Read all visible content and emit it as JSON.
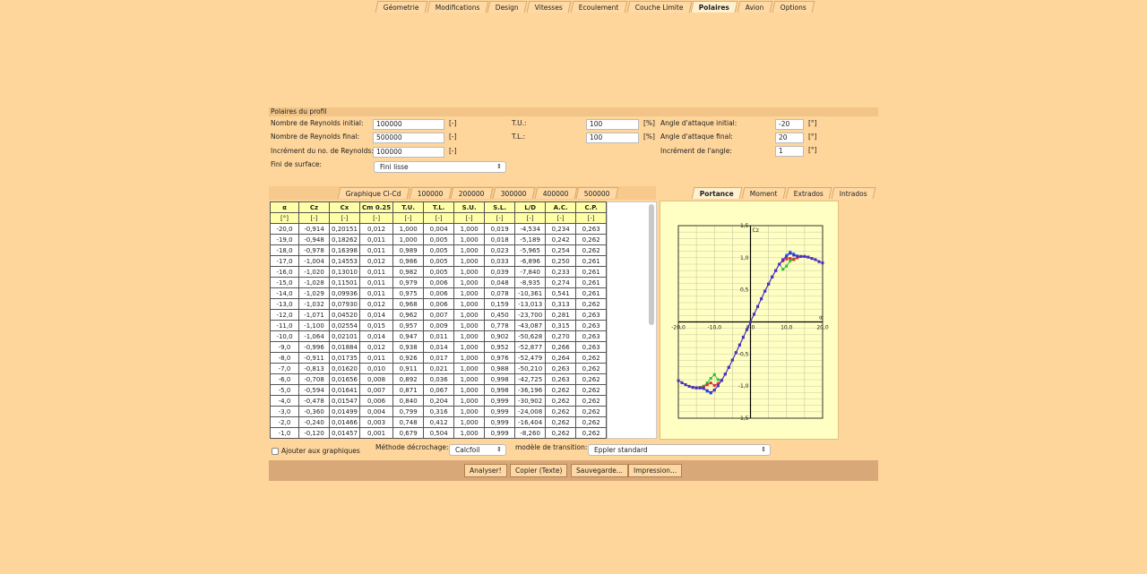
{
  "top_tabs": [
    {
      "label": "Géometrie"
    },
    {
      "label": "Modifications"
    },
    {
      "label": "Design"
    },
    {
      "label": "Vitesses"
    },
    {
      "label": "Ecoulement"
    },
    {
      "label": "Couche Limite"
    },
    {
      "label": "Polaires",
      "active": true
    },
    {
      "label": "Avion"
    },
    {
      "label": "Options"
    }
  ],
  "section_title": "Polaires du profil",
  "form": {
    "re_initial": {
      "label": "Nombre de Reynolds initial:",
      "value": "100000",
      "unit": "[-]"
    },
    "re_final": {
      "label": "Nombre de Reynolds final:",
      "value": "500000",
      "unit": "[-]"
    },
    "re_increment": {
      "label": "Incrément du no. de Reynolds:",
      "value": "100000",
      "unit": "[-]"
    },
    "surface": {
      "label": "Fini de surface:",
      "value": "Fini lisse"
    },
    "tu": {
      "label": "T.U.:",
      "value": "100",
      "unit": "[%]"
    },
    "tl": {
      "label": "T.L.:",
      "value": "100",
      "unit": "[%]"
    },
    "aoa_initial": {
      "label": "Angle d'attaque initial:",
      "value": "-20",
      "unit": "[°]"
    },
    "aoa_final": {
      "label": "Angle d'attaque final:",
      "value": "20",
      "unit": "[°]"
    },
    "aoa_increment": {
      "label": "Incrément de l'angle:",
      "value": "1",
      "unit": "[°]"
    }
  },
  "result_tabs": [
    {
      "label": "Graphique Cl-Cd"
    },
    {
      "label": "100000"
    },
    {
      "label": "200000"
    },
    {
      "label": "300000"
    },
    {
      "label": "400000"
    },
    {
      "label": "500000"
    }
  ],
  "chart_tabs": [
    {
      "label": "Portance",
      "active": true
    },
    {
      "label": "Moment"
    },
    {
      "label": "Extrados"
    },
    {
      "label": "Intrados"
    }
  ],
  "table": {
    "headers": [
      "α",
      "Cz",
      "Cx",
      "Cm 0.25",
      "T.U.",
      "T.L.",
      "S.U.",
      "S.L.",
      "L/D",
      "A.C.",
      "C.P."
    ],
    "units": [
      "[°]",
      "[-]",
      "[-]",
      "[-]",
      "[-]",
      "[-]",
      "[-]",
      "[-]",
      "[-]",
      "[-]",
      "[-]"
    ],
    "rows": [
      [
        "-20,0",
        "-0,914",
        "0,20151",
        "0,012",
        "1,000",
        "0,004",
        "1,000",
        "0,019",
        "-4,534",
        "0,234",
        "0,263"
      ],
      [
        "-19,0",
        "-0,948",
        "0,18262",
        "0,011",
        "1,000",
        "0,005",
        "1,000",
        "0,018",
        "-5,189",
        "0,242",
        "0,262"
      ],
      [
        "-18,0",
        "-0,978",
        "0,16398",
        "0,011",
        "0,989",
        "0,005",
        "1,000",
        "0,023",
        "-5,965",
        "0,254",
        "0,262"
      ],
      [
        "-17,0",
        "-1,004",
        "0,14553",
        "0,012",
        "0,986",
        "0,005",
        "1,000",
        "0,033",
        "-6,896",
        "0,250",
        "0,261"
      ],
      [
        "-16,0",
        "-1,020",
        "0,13010",
        "0,011",
        "0,982",
        "0,005",
        "1,000",
        "0,039",
        "-7,840",
        "0,233",
        "0,261"
      ],
      [
        "-15,0",
        "-1,028",
        "0,11501",
        "0,011",
        "0,979",
        "0,006",
        "1,000",
        "0,048",
        "-8,935",
        "0,274",
        "0,261"
      ],
      [
        "-14,0",
        "-1,029",
        "0,09936",
        "0,011",
        "0,975",
        "0,006",
        "1,000",
        "0,078",
        "-10,361",
        "0,541",
        "0,261"
      ],
      [
        "-13,0",
        "-1,032",
        "0,07930",
        "0,012",
        "0,968",
        "0,006",
        "1,000",
        "0,159",
        "-13,013",
        "0,313",
        "0,262"
      ],
      [
        "-12,0",
        "-1,071",
        "0,04520",
        "0,014",
        "0,962",
        "0,007",
        "1,000",
        "0,450",
        "-23,700",
        "0,281",
        "0,263"
      ],
      [
        "-11,0",
        "-1,100",
        "0,02554",
        "0,015",
        "0,957",
        "0,009",
        "1,000",
        "0,778",
        "-43,087",
        "0,315",
        "0,263"
      ],
      [
        "-10,0",
        "-1,064",
        "0,02101",
        "0,014",
        "0,947",
        "0,011",
        "1,000",
        "0,902",
        "-50,628",
        "0,270",
        "0,263"
      ],
      [
        "-9,0",
        "-0,996",
        "0,01884",
        "0,012",
        "0,938",
        "0,014",
        "1,000",
        "0,952",
        "-52,877",
        "0,266",
        "0,263"
      ],
      [
        "-8,0",
        "-0,911",
        "0,01735",
        "0,011",
        "0,926",
        "0,017",
        "1,000",
        "0,976",
        "-52,479",
        "0,264",
        "0,262"
      ],
      [
        "-7,0",
        "-0,813",
        "0,01620",
        "0,010",
        "0,911",
        "0,021",
        "1,000",
        "0,988",
        "-50,210",
        "0,263",
        "0,262"
      ],
      [
        "-6,0",
        "-0,708",
        "0,01656",
        "0,008",
        "0,892",
        "0,036",
        "1,000",
        "0,998",
        "-42,725",
        "0,263",
        "0,262"
      ],
      [
        "-5,0",
        "-0,594",
        "0,01641",
        "0,007",
        "0,871",
        "0,067",
        "1,000",
        "0,998",
        "-36,196",
        "0,262",
        "0,262"
      ],
      [
        "-4,0",
        "-0,478",
        "0,01547",
        "0,006",
        "0,840",
        "0,204",
        "1,000",
        "0,999",
        "-30,902",
        "0,262",
        "0,262"
      ],
      [
        "-3,0",
        "-0,360",
        "0,01499",
        "0,004",
        "0,799",
        "0,316",
        "1,000",
        "0,999",
        "-24,008",
        "0,262",
        "0,262"
      ],
      [
        "-2,0",
        "-0,240",
        "0,01466",
        "0,003",
        "0,748",
        "0,412",
        "1,000",
        "0,999",
        "-16,404",
        "0,262",
        "0,262"
      ],
      [
        "-1,0",
        "-0,120",
        "0,01457",
        "0,001",
        "0,679",
        "0,504",
        "1,000",
        "0,999",
        "-8,260",
        "0,262",
        "0,262"
      ]
    ]
  },
  "options": {
    "add_to_graphs": "Ajouter aux graphiques",
    "stall_label": "Méthode décrochage:",
    "stall_value": "Calcfoil",
    "transition_label": "modèle de transition:",
    "transition_value": "Eppler standard"
  },
  "buttons": {
    "analyze": "Analyser!",
    "copy": "Copier (Texte)",
    "save": "Sauvegarde...",
    "print": "Impression..."
  },
  "chart_data": {
    "type": "line",
    "xlabel": "α",
    "ylabel": "Cz",
    "xlim": [
      -20,
      20
    ],
    "ylim": [
      -1.5,
      1.5
    ],
    "xticks": [
      "-20,0",
      "-10,0",
      "0,0",
      "10,0",
      "20,0"
    ],
    "yticks": [
      "1,5",
      "1,0",
      "0,5",
      "0,0",
      "-0,5",
      "-1,0",
      "-1,5"
    ],
    "x": [
      -20,
      -19,
      -18,
      -17,
      -16,
      -15,
      -14,
      -13,
      -12,
      -11,
      -10,
      -9,
      -8,
      -7,
      -6,
      -5,
      -4,
      -3,
      -2,
      -1,
      0,
      1,
      2,
      3,
      4,
      5,
      6,
      7,
      8,
      9,
      10,
      11,
      12,
      13,
      14,
      15,
      16,
      17,
      18,
      19,
      20
    ],
    "series": [
      {
        "name": "100000",
        "color": "#30c030",
        "values": [
          -0.914,
          -0.948,
          -0.978,
          -1.004,
          -1.02,
          -1.028,
          -1.02,
          -1.0,
          -0.95,
          -0.88,
          -0.82,
          -0.9,
          -0.911,
          -0.813,
          -0.708,
          -0.594,
          -0.478,
          -0.36,
          -0.24,
          -0.12,
          0,
          0.12,
          0.24,
          0.36,
          0.48,
          0.59,
          0.7,
          0.8,
          0.9,
          0.82,
          0.87,
          0.95,
          0.98,
          1.0,
          1.02,
          1.02,
          1.01,
          0.99,
          0.97,
          0.94,
          0.92
        ]
      },
      {
        "name": "200000",
        "color": "#e03030",
        "values": [
          -0.914,
          -0.948,
          -0.978,
          -1.004,
          -1.02,
          -1.028,
          -1.025,
          -1.01,
          -0.98,
          -0.95,
          -0.99,
          -0.96,
          -0.911,
          -0.813,
          -0.708,
          -0.594,
          -0.478,
          -0.36,
          -0.24,
          -0.12,
          0,
          0.12,
          0.24,
          0.36,
          0.48,
          0.59,
          0.7,
          0.8,
          0.9,
          0.95,
          0.98,
          0.99,
          0.97,
          1.0,
          1.02,
          1.02,
          1.01,
          0.99,
          0.97,
          0.94,
          0.92
        ]
      },
      {
        "name": "400000",
        "color": "#2080ff",
        "values": [
          -0.914,
          -0.948,
          -0.978,
          -1.004,
          -1.02,
          -1.028,
          -1.029,
          -1.04,
          -1.08,
          -1.11,
          -1.06,
          -0.996,
          -0.911,
          -0.813,
          -0.708,
          -0.594,
          -0.478,
          -0.36,
          -0.24,
          -0.12,
          0,
          0.12,
          0.24,
          0.36,
          0.48,
          0.59,
          0.7,
          0.8,
          0.9,
          0.97,
          1.04,
          1.09,
          1.06,
          1.03,
          1.02,
          1.02,
          1.01,
          0.99,
          0.97,
          0.94,
          0.92
        ]
      },
      {
        "name": "500000",
        "color": "#5030c0",
        "values": [
          -0.914,
          -0.948,
          -0.978,
          -1.004,
          -1.02,
          -1.028,
          -1.029,
          -1.032,
          -1.071,
          -1.1,
          -1.064,
          -0.996,
          -0.911,
          -0.813,
          -0.708,
          -0.594,
          -0.478,
          -0.36,
          -0.24,
          -0.12,
          0,
          0.12,
          0.24,
          0.36,
          0.48,
          0.59,
          0.7,
          0.8,
          0.9,
          0.97,
          1.02,
          1.07,
          1.04,
          1.02,
          1.02,
          1.02,
          1.01,
          0.99,
          0.97,
          0.94,
          0.92
        ]
      }
    ]
  }
}
